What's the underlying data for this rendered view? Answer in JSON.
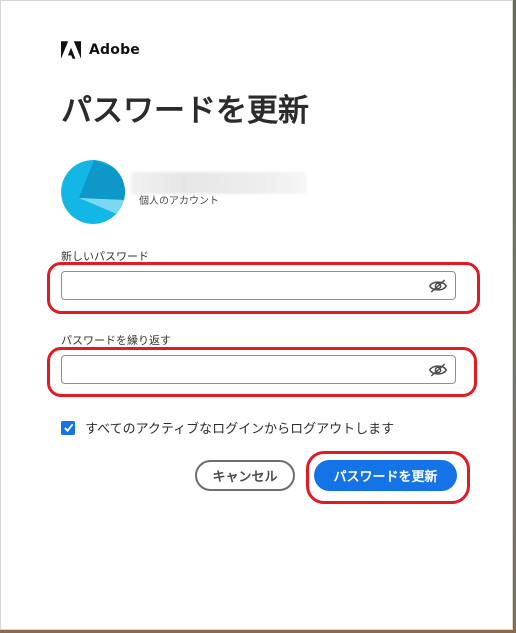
{
  "brand": {
    "name": "Adobe"
  },
  "page": {
    "title": "パスワードを更新"
  },
  "account": {
    "type_label": "個人のアカウント"
  },
  "fields": {
    "new_password": {
      "label": "新しいパスワード",
      "value": ""
    },
    "repeat_password": {
      "label": "パスワードを繰り返す",
      "value": ""
    }
  },
  "options": {
    "logout_all": {
      "label": "すべてのアクティブなログインからログアウトします",
      "checked": true
    }
  },
  "actions": {
    "cancel_label": "キャンセル",
    "submit_label": "パスワードを更新"
  },
  "colors": {
    "accent": "#1473e6",
    "avatar": "#13b7e6",
    "annotation": "#e01b24",
    "title": "#2b2b2b"
  },
  "icons": [
    "adobe-logo-icon",
    "eye-slash-icon",
    "checkmark-icon"
  ]
}
